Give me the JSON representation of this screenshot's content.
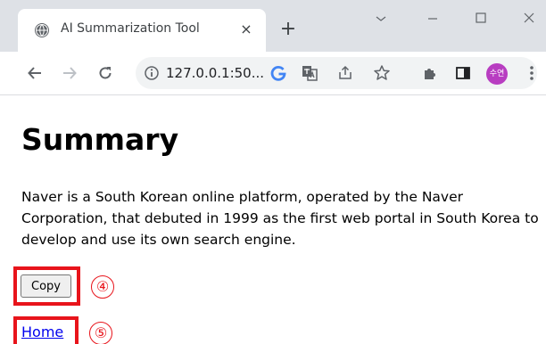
{
  "browser": {
    "tab_title": "AI Summarization Tool",
    "tab_close": "×",
    "new_tab": "+",
    "url": "127.0.0.1:50...",
    "avatar_text": "수연",
    "colors": {
      "tabstrip_bg": "#dee1e6",
      "omnibox_bg": "#f1f3f4",
      "avatar_bg": "#b83dc1",
      "google_blue": "#4285f4"
    },
    "icons": [
      "globe-icon",
      "close-icon",
      "new-tab-icon",
      "back-icon",
      "forward-icon",
      "reload-icon",
      "info-icon",
      "google-icon",
      "translate-icon",
      "share-icon",
      "star-icon",
      "extensions-icon",
      "sidepanel-icon",
      "avatar",
      "more-icon"
    ]
  },
  "page": {
    "title": "Summary",
    "summary": "Naver is a South Korean online platform, operated by the Naver Corporation, that debuted in 1999 as the first web portal in South Korea to develop and use its own search engine.",
    "copy_label": "Copy",
    "home_label": "Home"
  },
  "annotations": {
    "copy_marker": "④",
    "home_marker": "⑤",
    "color": "#e8141b"
  }
}
